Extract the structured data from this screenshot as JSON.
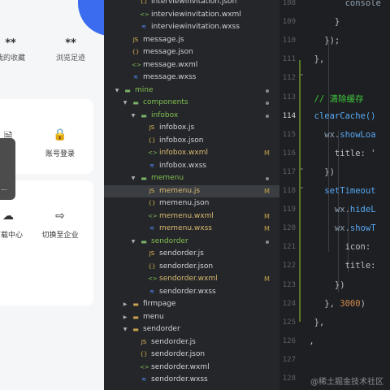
{
  "preview": {
    "stats": [
      {
        "value": "**",
        "label": "我的收藏"
      },
      {
        "value": "**",
        "label": "浏览足迹"
      }
    ],
    "menu1": [
      {
        "icon": "doc-icon",
        "label": "企业"
      },
      {
        "icon": "lock-icon",
        "label": "账号登录"
      }
    ],
    "menu2": [
      {
        "icon": "cloud-icon",
        "label": "下载中心"
      },
      {
        "icon": "switch-icon",
        "label": "切换至企业"
      }
    ],
    "toast_text": "..."
  },
  "explorer": {
    "rows": [
      {
        "name": "interviewinvitation.json",
        "type": "json",
        "depth": 3,
        "state": ""
      },
      {
        "name": "interviewinvitation.wxml",
        "type": "wxml",
        "depth": 3,
        "state": ""
      },
      {
        "name": "interviewinvitation.wxss",
        "type": "wxss",
        "depth": 3,
        "state": ""
      },
      {
        "name": "message.js",
        "type": "js",
        "depth": 2,
        "state": ""
      },
      {
        "name": "message.json",
        "type": "json",
        "depth": 2,
        "state": ""
      },
      {
        "name": "message.wxml",
        "type": "wxml",
        "depth": 2,
        "state": ""
      },
      {
        "name": "message.wxss",
        "type": "wxss",
        "depth": 2,
        "state": ""
      },
      {
        "name": "mine",
        "type": "folder",
        "depth": 1,
        "state": "dot",
        "open": true,
        "green": true
      },
      {
        "name": "components",
        "type": "folder",
        "depth": 2,
        "state": "dot",
        "open": true,
        "green": true
      },
      {
        "name": "infobox",
        "type": "folder",
        "depth": 3,
        "state": "dot",
        "open": true,
        "green": true
      },
      {
        "name": "infobox.js",
        "type": "js",
        "depth": 4,
        "state": ""
      },
      {
        "name": "infobox.json",
        "type": "json",
        "depth": 4,
        "state": ""
      },
      {
        "name": "infobox.wxml",
        "type": "wxml",
        "depth": 4,
        "state": "M"
      },
      {
        "name": "infobox.wxss",
        "type": "wxss",
        "depth": 4,
        "state": ""
      },
      {
        "name": "memenu",
        "type": "folder",
        "depth": 3,
        "state": "dot",
        "open": true,
        "green": true
      },
      {
        "name": "memenu.js",
        "type": "js",
        "depth": 4,
        "state": "M",
        "selected": true
      },
      {
        "name": "memenu.json",
        "type": "json",
        "depth": 4,
        "state": ""
      },
      {
        "name": "memenu.wxml",
        "type": "wxml",
        "depth": 4,
        "state": "M"
      },
      {
        "name": "memenu.wxss",
        "type": "wxss",
        "depth": 4,
        "state": "M"
      },
      {
        "name": "sendorder",
        "type": "folder",
        "depth": 3,
        "state": "dot",
        "open": true,
        "green": true
      },
      {
        "name": "sendorder.js",
        "type": "js",
        "depth": 4,
        "state": ""
      },
      {
        "name": "sendorder.json",
        "type": "json",
        "depth": 4,
        "state": ""
      },
      {
        "name": "sendorder.wxml",
        "type": "wxml",
        "depth": 4,
        "state": "M"
      },
      {
        "name": "sendorder.wxss",
        "type": "wxss",
        "depth": 4,
        "state": ""
      },
      {
        "name": "firmpage",
        "type": "folder",
        "depth": 2,
        "state": "",
        "open": false
      },
      {
        "name": "menu",
        "type": "folder",
        "depth": 2,
        "state": "",
        "open": false
      },
      {
        "name": "sendorder",
        "type": "folder",
        "depth": 2,
        "state": "",
        "open": true
      },
      {
        "name": "sendorder.js",
        "type": "js",
        "depth": 3,
        "state": ""
      },
      {
        "name": "sendorder.json",
        "type": "json",
        "depth": 3,
        "state": ""
      },
      {
        "name": "sendorder.wxml",
        "type": "wxml",
        "depth": 3,
        "state": ""
      },
      {
        "name": "sendorder.wxss",
        "type": "wxss",
        "depth": 3,
        "state": ""
      },
      {
        "name": "userpage",
        "type": "folder",
        "depth": 2,
        "state": "",
        "open": false
      }
    ]
  },
  "editor": {
    "line_numbers": [
      "108",
      "109",
      "110",
      "111",
      "112",
      "113",
      "114",
      "115",
      "116",
      "117",
      "118",
      "119",
      "120",
      "121",
      "122",
      "123",
      "124",
      "125",
      "126",
      "127",
      "128"
    ],
    "current_line": "114",
    "lines": [
      [
        {
          "t": "        ",
          "c": "k-pun"
        },
        {
          "t": "console",
          "c": "k-id"
        }
      ],
      [
        {
          "t": "      }",
          "c": "k-pun"
        }
      ],
      [
        {
          "t": "    });",
          "c": "k-pun"
        }
      ],
      [
        {
          "t": "  },",
          "c": "k-pun"
        }
      ],
      [
        {
          "t": "",
          "c": "k-pun"
        }
      ],
      [
        {
          "t": "  // 清除缓存",
          "c": "k-cm"
        }
      ],
      [
        {
          "t": "  clearCache()",
          "c": "k-fn"
        }
      ],
      [
        {
          "t": "    wx.",
          "c": "k-id"
        },
        {
          "t": "showLoa",
          "c": "k-fn"
        }
      ],
      [
        {
          "t": "      title: '",
          "c": "k-pun"
        }
      ],
      [
        {
          "t": "    })",
          "c": "k-pun"
        }
      ],
      [
        {
          "t": "    setTimeout",
          "c": "k-fn"
        }
      ],
      [
        {
          "t": "      wx.",
          "c": "k-id"
        },
        {
          "t": "hideL",
          "c": "k-fn"
        }
      ],
      [
        {
          "t": "      wx.",
          "c": "k-id"
        },
        {
          "t": "showT",
          "c": "k-fn"
        }
      ],
      [
        {
          "t": "        icon: ",
          "c": "k-pun"
        }
      ],
      [
        {
          "t": "        title:",
          "c": "k-pun"
        }
      ],
      [
        {
          "t": "      })",
          "c": "k-pun"
        }
      ],
      [
        {
          "t": "    }, ",
          "c": "k-pun"
        },
        {
          "t": "3000",
          "c": "k-num"
        },
        {
          "t": ")",
          "c": "k-pun"
        }
      ],
      [
        {
          "t": "  },",
          "c": "k-pun"
        }
      ],
      [
        {
          "t": "},",
          "c": "k-pun"
        }
      ],
      [
        {
          "t": "",
          "c": "k-pun"
        }
      ],
      [
        {
          "t": "",
          "c": "k-pun"
        }
      ]
    ]
  },
  "watermark": "@稀土掘金技术社区"
}
